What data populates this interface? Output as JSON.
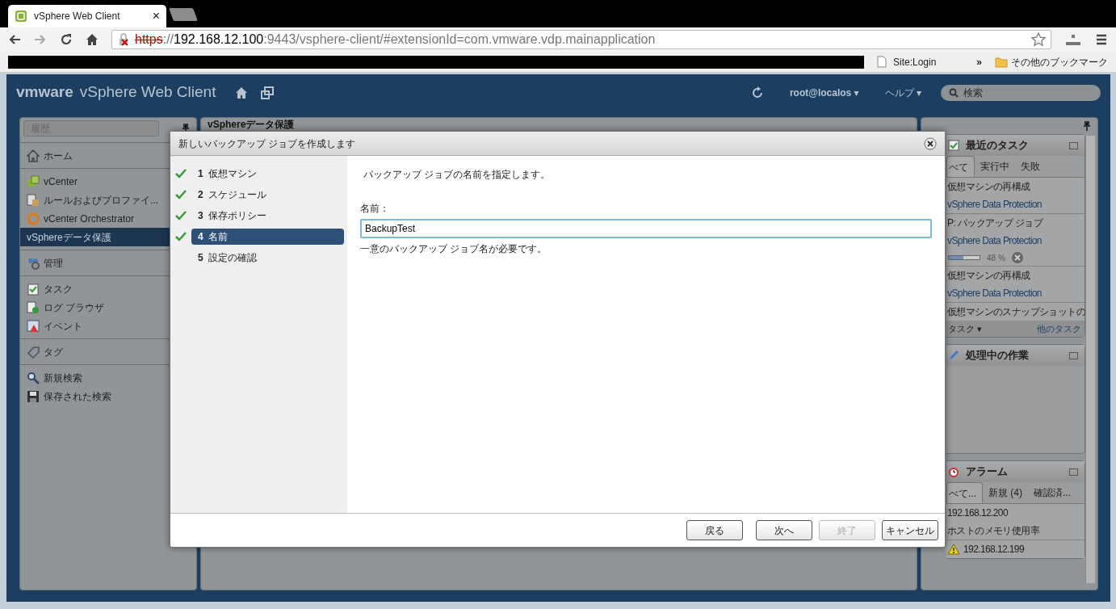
{
  "browser": {
    "tab": {
      "title": "vSphere Web Client",
      "close": "×"
    },
    "address": {
      "scheme": "https",
      "separator": "://",
      "host": "192.168.12.100",
      "rest": ":9443/vsphere-client/#extensionId=com.vmware.vdp.mainapplication",
      "secure": false
    },
    "bookmarks": {
      "items": [
        {
          "label": "Site:Login"
        }
      ],
      "overflow": "»",
      "other": "その他のブックマーク"
    }
  },
  "app": {
    "brand": "vmware",
    "product": "vSphere Web Client",
    "user": "root@localos",
    "user_caret": "▾",
    "help": "ヘルプ",
    "help_caret": "▾",
    "search_placeholder": "検索"
  },
  "navigator": {
    "history": "履歴",
    "groups": [
      {
        "items": [
          {
            "label": "ホーム",
            "kind": "home",
            "selected": false
          }
        ]
      },
      {
        "items": [
          {
            "label": "vCenter",
            "kind": "vcenter",
            "selected": false
          },
          {
            "label": "ルールおよびプロファイ...",
            "kind": "rules",
            "selected": false
          },
          {
            "label": "vCenter Orchestrator",
            "kind": "orchestrator",
            "selected": false
          },
          {
            "label": "vSphereデータ保護",
            "kind": "plain",
            "selected": true
          }
        ]
      },
      {
        "items": [
          {
            "label": "管理",
            "kind": "admin",
            "selected": false
          }
        ]
      },
      {
        "items": [
          {
            "label": "タスク",
            "kind": "tasks",
            "selected": false
          },
          {
            "label": "ログ ブラウザ",
            "kind": "log",
            "selected": false
          },
          {
            "label": "イベント",
            "kind": "events",
            "selected": false
          }
        ]
      },
      {
        "items": [
          {
            "label": "タグ",
            "kind": "tag",
            "selected": false
          }
        ]
      },
      {
        "items": [
          {
            "label": "新規検索",
            "kind": "search",
            "selected": false
          },
          {
            "label": "保存された検索",
            "kind": "saved",
            "selected": false
          }
        ]
      }
    ]
  },
  "center": {
    "title": "vSphereデータ保護"
  },
  "wizard": {
    "title": "新しいバックアップ ジョブを作成します",
    "steps": [
      {
        "number": "1",
        "label": "仮想マシン",
        "done": true,
        "selected": false
      },
      {
        "number": "2",
        "label": "スケジュール",
        "done": true,
        "selected": false
      },
      {
        "number": "3",
        "label": "保存ポリシー",
        "done": true,
        "selected": false
      },
      {
        "number": "4",
        "label": "名前",
        "done": true,
        "selected": true
      },
      {
        "number": "5",
        "label": "設定の確認",
        "done": false,
        "selected": false
      }
    ],
    "heading": "バックアップ ジョブの名前を指定します。",
    "field_label": "名前：",
    "value": "BackupTest",
    "hint": "一意のバックアップ ジョブ名が必要です。",
    "buttons": [
      {
        "label": "戻る",
        "disabled": false
      },
      {
        "label": "次へ",
        "disabled": false
      },
      {
        "label": "終了",
        "disabled": true
      },
      {
        "label": "キャンセル",
        "disabled": false
      }
    ]
  },
  "right_panel": {
    "tasks": {
      "title": "最近のタスク",
      "tabs": [
        {
          "label": "べて",
          "selected": true
        },
        {
          "label": "実行中",
          "selected": false
        },
        {
          "label": "失敗",
          "selected": false
        }
      ],
      "items": [
        {
          "name": "仮想マシンの再構成",
          "target": "vSphere Data Protection"
        },
        {
          "name": "P: バックアップ ジョブ",
          "target": "vSphere Data Protection",
          "level": 0.48,
          "reading": "48 %"
        },
        {
          "name": "仮想マシンの再構成",
          "target": "vSphere Data Protection"
        },
        {
          "name": "仮想マシンのスナップショットの"
        }
      ],
      "filter": "タスク",
      "filter_caret": "▾",
      "more": "他のタスク"
    },
    "work": {
      "title": "処理中の作業"
    },
    "alarms": {
      "title": "アラーム",
      "tabs": [
        {
          "label": "べて...",
          "selected": true
        },
        {
          "label": "新規 (4)",
          "selected": false
        },
        {
          "label": "確認済...",
          "selected": false
        }
      ],
      "items": [
        {
          "name": "192.168.12.200",
          "detail": "ホストのメモリ使用率",
          "kind": "host"
        },
        {
          "name": "192.168.12.199",
          "kind": "warning"
        }
      ]
    }
  }
}
